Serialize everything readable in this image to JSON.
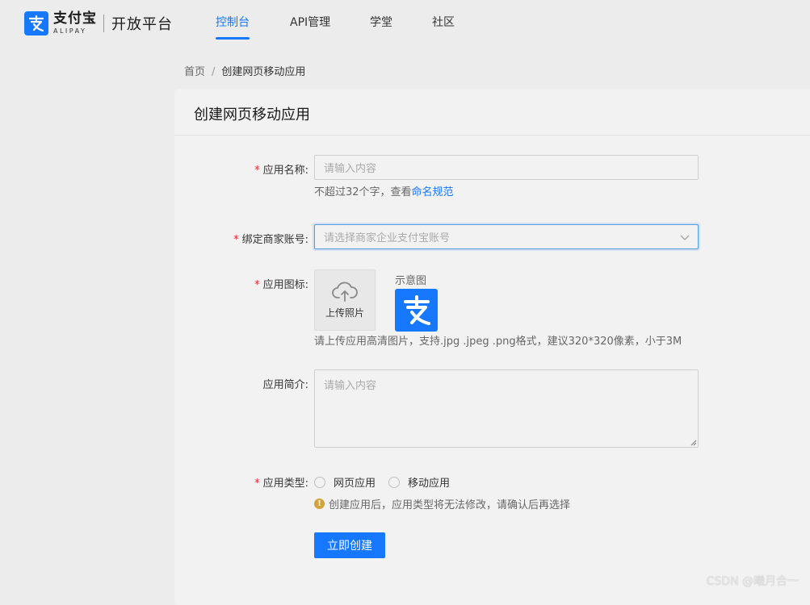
{
  "header": {
    "logo_cn": "支付宝",
    "logo_en": "ALIPAY",
    "platform": "开放平台",
    "nav": [
      {
        "label": "控制台",
        "active": true
      },
      {
        "label": "API管理",
        "active": false
      },
      {
        "label": "学堂",
        "active": false
      },
      {
        "label": "社区",
        "active": false
      }
    ]
  },
  "breadcrumb": {
    "home": "首页",
    "separator": "/",
    "current": "创建网页移动应用"
  },
  "card": {
    "title": "创建网页移动应用"
  },
  "form": {
    "required_mark": "*",
    "app_name": {
      "label": "应用名称:",
      "placeholder": "请输入内容",
      "helper_prefix": "不超过32个字，查看",
      "helper_link": "命名规范"
    },
    "merchant": {
      "label": "绑定商家账号:",
      "placeholder": "请选择商家企业支付宝账号"
    },
    "icon": {
      "label": "应用图标:",
      "upload_label": "上传照片",
      "preview_label": "示意图",
      "helper": "请上传应用高清图片，支持.jpg .jpeg .png格式，建议320*320像素，小于3M"
    },
    "intro": {
      "label": "应用简介:",
      "placeholder": "请输入内容"
    },
    "app_type": {
      "label": "应用类型:",
      "options": [
        "网页应用",
        "移动应用"
      ],
      "warning_icon": "!",
      "warning": "创建应用后，应用类型将无法修改，请确认后再选择"
    },
    "submit_label": "立即创建"
  },
  "watermark": "CSDN @曦月合一",
  "colors": {
    "brand": "#1677ff",
    "required": "#f5222d",
    "warning": "#d4a23a"
  },
  "icons": {
    "logo": "alipay-logo-icon",
    "upload": "cloud-upload-icon",
    "select": "chevron-down-icon",
    "warning": "exclamation-circle-icon"
  }
}
